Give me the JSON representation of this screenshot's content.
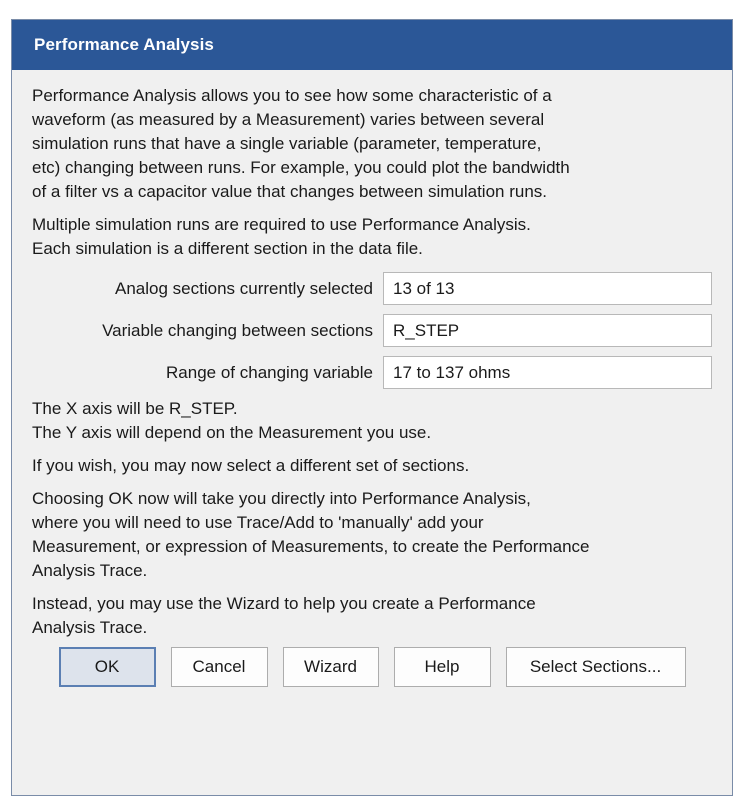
{
  "window": {
    "title": "Performance Analysis"
  },
  "intro": {
    "lines": [
      "Performance Analysis allows you to see how some characteristic of a",
      "waveform (as measured by a Measurement) varies between several",
      "simulation runs that have a single variable (parameter, temperature,",
      "etc) changing between runs.  For example, you could plot the bandwidth",
      "of a filter vs a capacitor value that changes between simulation runs."
    ]
  },
  "requirement": {
    "lines": [
      "Multiple simulation runs are required to use Performance Analysis.",
      "Each simulation is a different section in the data file."
    ]
  },
  "fields": [
    {
      "label": "Analog sections currently selected",
      "value": "13 of 13"
    },
    {
      "label": "Variable changing between sections",
      "value": "R_STEP"
    },
    {
      "label": "Range of changing variable",
      "value": "17 to 137 ohms"
    }
  ],
  "axis_info": {
    "lines": [
      "The X axis will be R_STEP.",
      "The Y axis will depend on the Measurement you use."
    ]
  },
  "select_note": "If you wish, you may now select a different set of sections.",
  "ok_note": {
    "lines": [
      "Choosing OK now will take you directly into Performance Analysis,",
      "where you will need to use Trace/Add to 'manually' add your",
      "Measurement, or expression of Measurements, to create the Performance",
      "Analysis Trace."
    ]
  },
  "wizard_note": {
    "lines": [
      "Instead, you may use the Wizard to help you create a Performance",
      "Analysis Trace."
    ]
  },
  "buttons": {
    "ok": "OK",
    "cancel": "Cancel",
    "wizard": "Wizard",
    "help": "Help",
    "select_sections": "Select Sections..."
  },
  "colors": {
    "titlebar": "#2b5797",
    "dialog_bg": "#f0f0f0"
  }
}
